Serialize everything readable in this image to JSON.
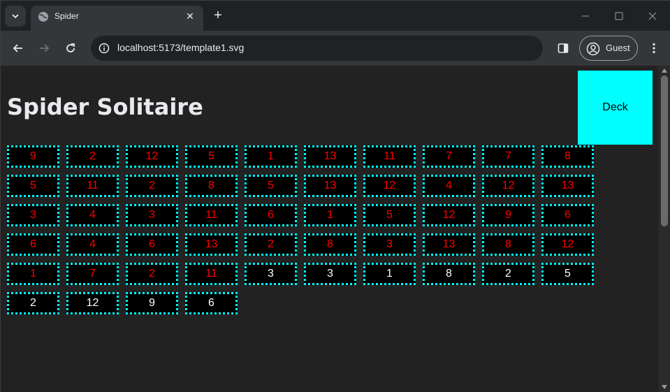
{
  "browser": {
    "tab_title": "Spider",
    "url": "localhost:5173/template1.svg",
    "profile_label": "Guest"
  },
  "page": {
    "title": "Spider Solitaire",
    "deck_label": "Deck"
  },
  "colors": {
    "card_face_down_text": "#ff0000",
    "card_face_up_text": "#ffffff",
    "card_border": "#00ffff",
    "deck_background": "#00ffff"
  },
  "columns": [
    [
      {
        "v": "9",
        "up": false
      },
      {
        "v": "5",
        "up": false
      },
      {
        "v": "3",
        "up": false
      },
      {
        "v": "6",
        "up": false
      },
      {
        "v": "1",
        "up": false
      },
      {
        "v": "2",
        "up": true
      }
    ],
    [
      {
        "v": "2",
        "up": false
      },
      {
        "v": "11",
        "up": false
      },
      {
        "v": "4",
        "up": false
      },
      {
        "v": "4",
        "up": false
      },
      {
        "v": "7",
        "up": false
      },
      {
        "v": "12",
        "up": true
      }
    ],
    [
      {
        "v": "12",
        "up": false
      },
      {
        "v": "2",
        "up": false
      },
      {
        "v": "3",
        "up": false
      },
      {
        "v": "6",
        "up": false
      },
      {
        "v": "2",
        "up": false
      },
      {
        "v": "9",
        "up": true
      }
    ],
    [
      {
        "v": "5",
        "up": false
      },
      {
        "v": "8",
        "up": false
      },
      {
        "v": "11",
        "up": false
      },
      {
        "v": "13",
        "up": false
      },
      {
        "v": "11",
        "up": false
      },
      {
        "v": "6",
        "up": true
      }
    ],
    [
      {
        "v": "1",
        "up": false
      },
      {
        "v": "5",
        "up": false
      },
      {
        "v": "6",
        "up": false
      },
      {
        "v": "2",
        "up": false
      },
      {
        "v": "3",
        "up": true
      }
    ],
    [
      {
        "v": "13",
        "up": false
      },
      {
        "v": "13",
        "up": false
      },
      {
        "v": "1",
        "up": false
      },
      {
        "v": "8",
        "up": false
      },
      {
        "v": "3",
        "up": true
      }
    ],
    [
      {
        "v": "11",
        "up": false
      },
      {
        "v": "12",
        "up": false
      },
      {
        "v": "5",
        "up": false
      },
      {
        "v": "3",
        "up": false
      },
      {
        "v": "1",
        "up": true
      }
    ],
    [
      {
        "v": "7",
        "up": false
      },
      {
        "v": "4",
        "up": false
      },
      {
        "v": "12",
        "up": false
      },
      {
        "v": "13",
        "up": false
      },
      {
        "v": "8",
        "up": true
      }
    ],
    [
      {
        "v": "7",
        "up": false
      },
      {
        "v": "12",
        "up": false
      },
      {
        "v": "9",
        "up": false
      },
      {
        "v": "8",
        "up": false
      },
      {
        "v": "2",
        "up": true
      }
    ],
    [
      {
        "v": "8",
        "up": false
      },
      {
        "v": "13",
        "up": false
      },
      {
        "v": "6",
        "up": false
      },
      {
        "v": "12",
        "up": false
      },
      {
        "v": "5",
        "up": true
      }
    ]
  ]
}
